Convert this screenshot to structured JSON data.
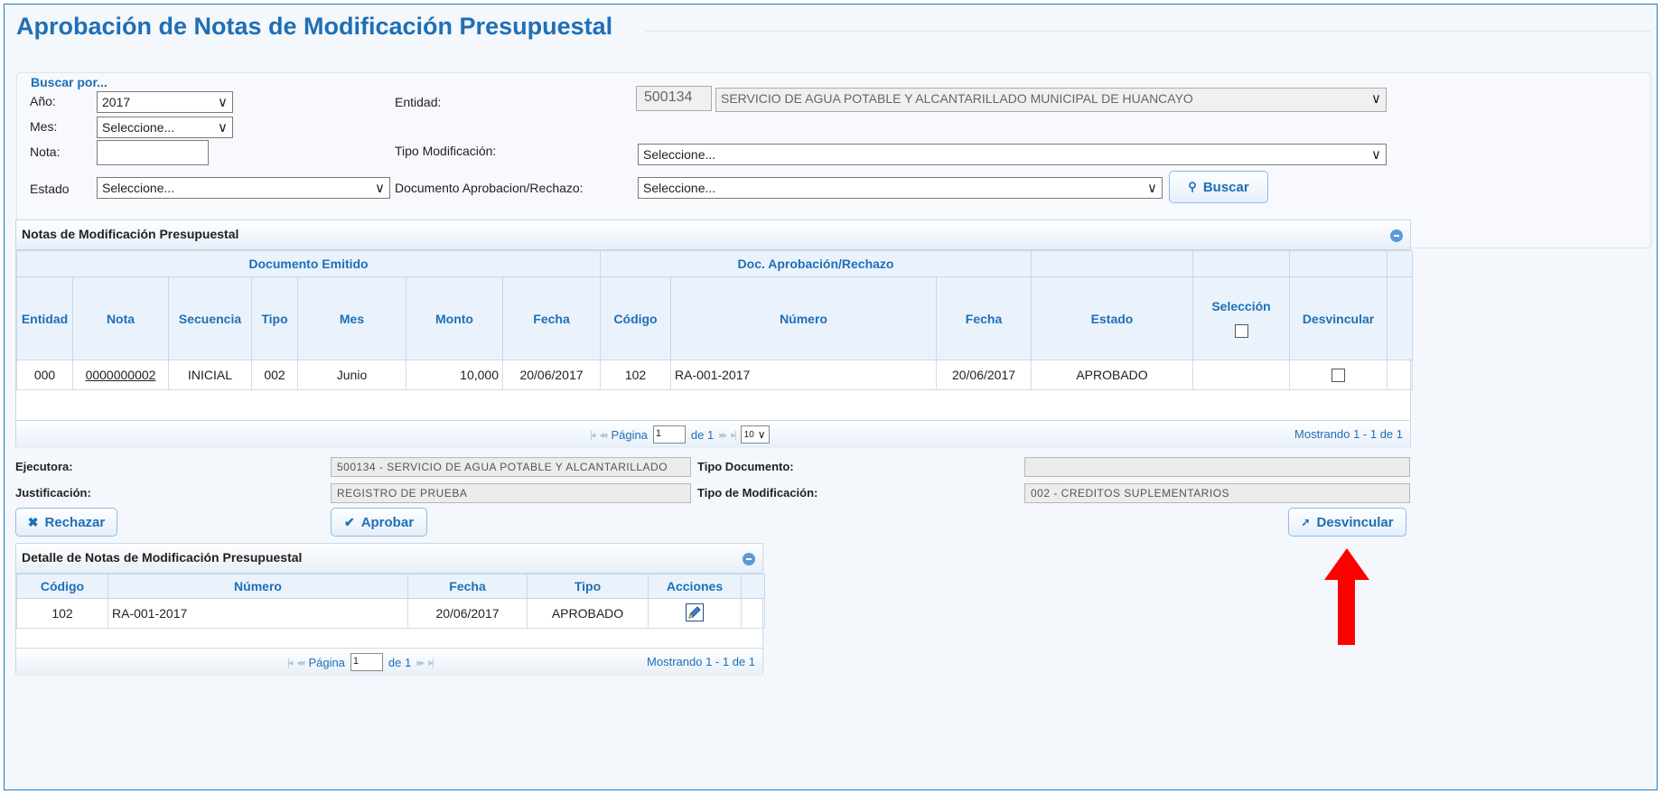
{
  "page": {
    "title": "Aprobación de Notas de Modificación Presupuestal"
  },
  "search": {
    "legend": "Buscar por...",
    "year_label": "Año:",
    "year_value": "2017",
    "month_label": "Mes:",
    "month_value": "Seleccione...",
    "note_label": "Nota:",
    "note_value": "",
    "status_label": "Estado",
    "status_value": "Seleccione...",
    "entity_label": "Entidad:",
    "entity_code": "500134",
    "entity_name": "SERVICIO DE AGUA POTABLE Y ALCANTARILLADO MUNICIPAL DE HUANCAYO",
    "mod_type_label": "Tipo Modificación:",
    "mod_type_value": "Seleccione...",
    "doc_label": "Documento Aprobacion/Rechazo:",
    "doc_value": "Seleccione...",
    "search_button": "Buscar"
  },
  "grid": {
    "title": "Notas de Modificación Presupuestal",
    "group_emitted": "Documento Emitido",
    "group_approval": "Doc. Aprobación/Rechazo",
    "columns": [
      "Entidad",
      "Nota",
      "Secuencia",
      "Tipo",
      "Mes",
      "Monto",
      "Fecha",
      "Código",
      "Número",
      "Fecha",
      "Estado",
      "Selección",
      "Desvincular"
    ],
    "rows": [
      {
        "entidad": "000",
        "nota": "0000000002",
        "secuencia": "INICIAL",
        "tipo": "002",
        "mes": "Junio",
        "monto": "10,000",
        "fecha": "20/06/2017",
        "codigo": "102",
        "numero": "RA-001-2017",
        "fecha2": "20/06/2017",
        "estado": "APROBADO",
        "seleccion_checked": false,
        "desvincular_checked": false
      }
    ],
    "pager": {
      "page_label": "Página",
      "page_value": "1",
      "of_label": "de 1",
      "page_size": "10",
      "summary": "Mostrando 1 - 1 de 1"
    }
  },
  "form": {
    "ejecutora_label": "Ejecutora:",
    "ejecutora_value": "500134 - SERVICIO DE AGUA POTABLE Y ALCANTARILLADO",
    "justificacion_label": "Justificación:",
    "justificacion_value": "REGISTRO DE PRUEBA",
    "tipo_documento_label": "Tipo Documento:",
    "tipo_documento_value": "",
    "tipo_modificacion_label": "Tipo de Modificación:",
    "tipo_modificacion_value": "002 - CREDITOS SUPLEMENTARIOS"
  },
  "actions": {
    "reject": "Rechazar",
    "approve": "Aprobar",
    "unlink": "Desvincular"
  },
  "detail": {
    "title": "Detalle de Notas de Modificación Presupuestal",
    "columns": [
      "Código",
      "Número",
      "Fecha",
      "Tipo",
      "Acciones"
    ],
    "rows": [
      {
        "codigo": "102",
        "numero": "RA-001-2017",
        "fecha": "20/06/2017",
        "tipo": "APROBADO"
      }
    ],
    "pager": {
      "page_label": "Página",
      "page_value": "1",
      "of_label": "de 1",
      "summary": "Mostrando 1 - 1 de 1"
    }
  },
  "colors": {
    "accent": "#1f6fb6",
    "annotation_arrow": "#ff0000"
  },
  "icons": {
    "search": "magnifier-icon",
    "reject": "close-icon",
    "approve": "check-icon",
    "unlink": "unlink-arrow-icon",
    "edit": "edit-pencil-icon",
    "collapse": "collapse-circle-icon",
    "annotation": "red-up-arrow"
  }
}
